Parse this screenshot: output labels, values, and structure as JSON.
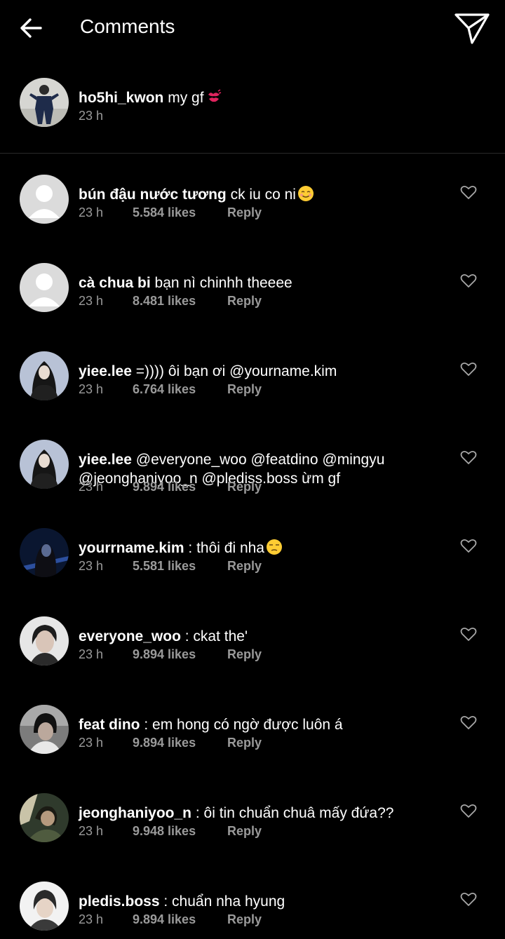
{
  "header": {
    "title": "Comments",
    "back_icon": "arrow-left-icon",
    "send_icon": "paper-plane-icon"
  },
  "caption": {
    "username": "ho5hi_kwon",
    "text": "my gf",
    "emoji": "kiss-mark",
    "time": "23 h"
  },
  "comments": [
    {
      "username": "bún đậu nước tương",
      "text": "ck iu co ni",
      "emoji": "smiling-face",
      "time": "23 h",
      "likes": "5.584 likes",
      "reply": "Reply"
    },
    {
      "username": "cà chua bi",
      "text": "bạn nì chinhh theeee",
      "time": "23 h",
      "likes": "8.481 likes",
      "reply": "Reply"
    },
    {
      "username": "yiee.lee",
      "text": "=)))) ôi bạn ơi @yourname.kim",
      "time": "23 h",
      "likes": "6.764 likes",
      "reply": "Reply"
    },
    {
      "username": "yiee.lee",
      "text": "@everyone_woo @featdino @mingyu @jeonghaniyoo_n @plediss.boss ừm gf",
      "time": "23 h",
      "likes": "9.894 likes",
      "reply": "Reply"
    },
    {
      "username": "yourrname.kim",
      "text": ": thôi đi nha",
      "emoji": "unamused-face",
      "time": "23 h",
      "likes": "5.581 likes",
      "reply": "Reply"
    },
    {
      "username": "everyone_woo",
      "text": ": ckat the'",
      "time": "23 h",
      "likes": "9.894 likes",
      "reply": "Reply"
    },
    {
      "username": "feat dino",
      "text": ": em hong có ngờ được luôn á",
      "time": "23 h",
      "likes": "9.894 likes",
      "reply": "Reply"
    },
    {
      "username": "jeonghaniyoo_n",
      "text": ": ôi tin chuẩn chuâ mấy đứa??",
      "time": "23 h",
      "likes": "9.948 likes",
      "reply": "Reply"
    },
    {
      "username": "pledis.boss",
      "text": ": chuẩn nha hyung",
      "time": "23 h",
      "likes": "9.894 likes",
      "reply": "Reply"
    }
  ],
  "colors": {
    "background": "#000000",
    "text": "#ffffff",
    "secondary_text": "#9a9a9a",
    "divider": "#2a2a2a"
  }
}
